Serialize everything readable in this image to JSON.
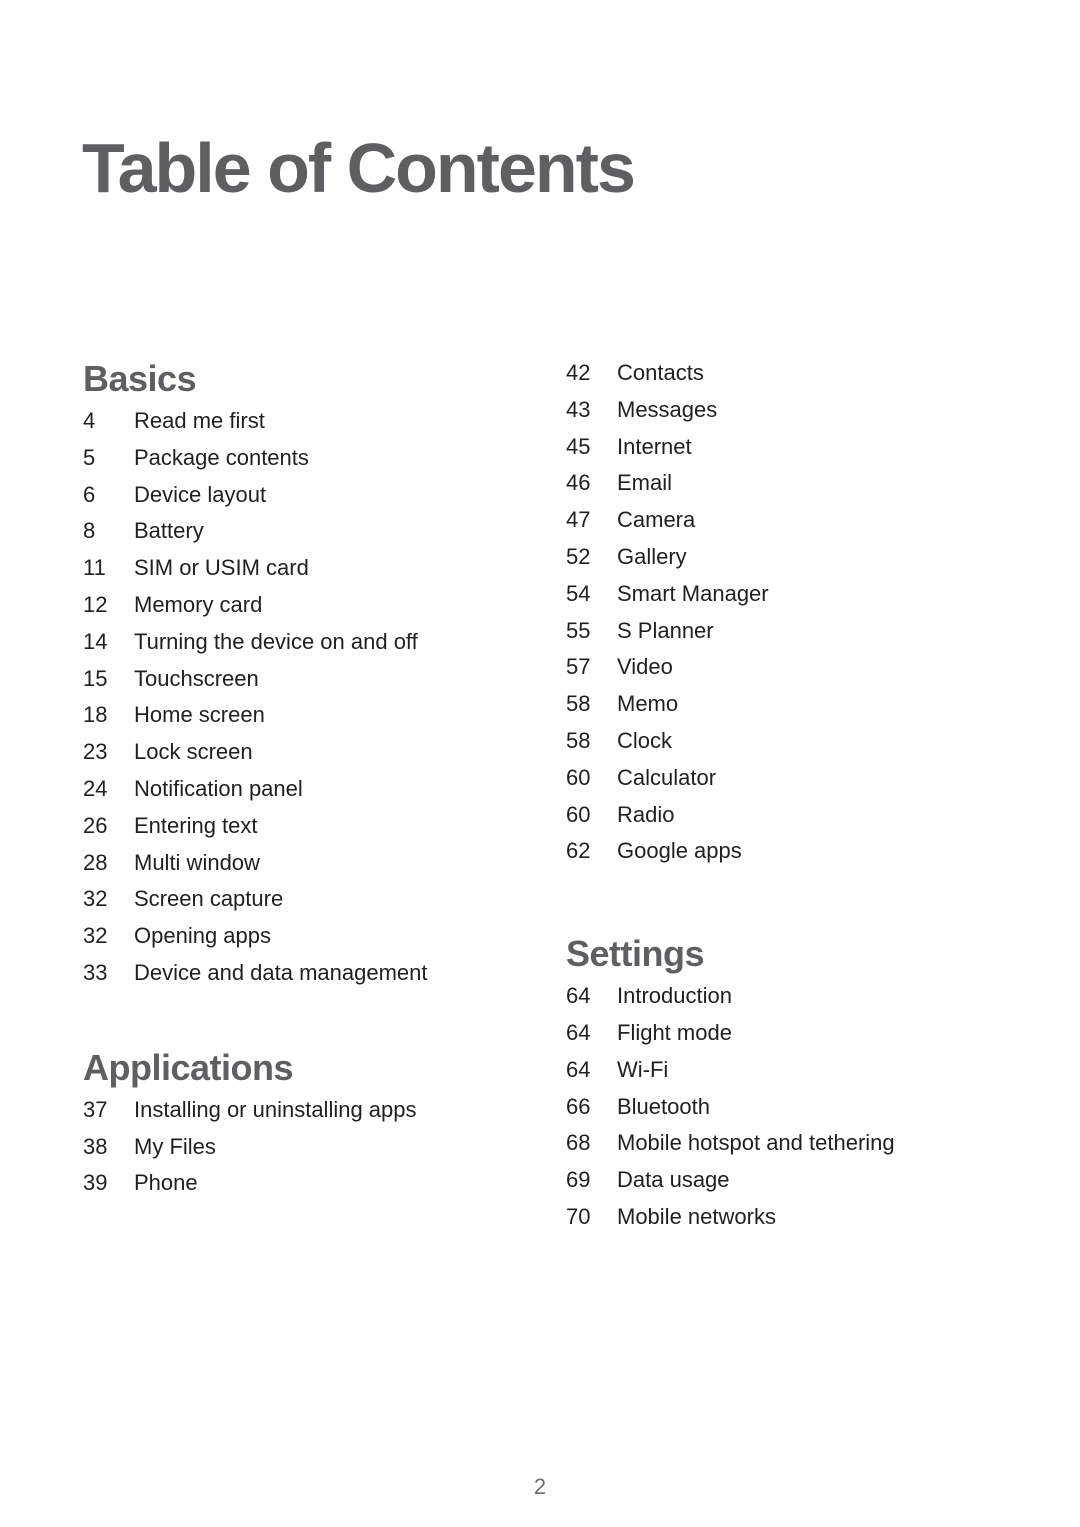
{
  "page_title": "Table of Contents",
  "left_column": {
    "sections": [
      {
        "title": "Basics",
        "items": [
          {
            "page": "4",
            "label": "Read me first"
          },
          {
            "page": "5",
            "label": "Package contents"
          },
          {
            "page": "6",
            "label": "Device layout"
          },
          {
            "page": "8",
            "label": "Battery"
          },
          {
            "page": "11",
            "label": "SIM or USIM card"
          },
          {
            "page": "12",
            "label": "Memory card"
          },
          {
            "page": "14",
            "label": "Turning the device on and off"
          },
          {
            "page": "15",
            "label": "Touchscreen"
          },
          {
            "page": "18",
            "label": "Home screen"
          },
          {
            "page": "23",
            "label": "Lock screen"
          },
          {
            "page": "24",
            "label": "Notification panel"
          },
          {
            "page": "26",
            "label": "Entering text"
          },
          {
            "page": "28",
            "label": "Multi window"
          },
          {
            "page": "32",
            "label": "Screen capture"
          },
          {
            "page": "32",
            "label": "Opening apps"
          },
          {
            "page": "33",
            "label": "Device and data management"
          }
        ]
      },
      {
        "title": "Applications",
        "items": [
          {
            "page": "37",
            "label": "Installing or uninstalling apps"
          },
          {
            "page": "38",
            "label": "My Files"
          },
          {
            "page": "39",
            "label": "Phone"
          }
        ]
      }
    ]
  },
  "right_column": {
    "continued_items": [
      {
        "page": "42",
        "label": "Contacts"
      },
      {
        "page": "43",
        "label": "Messages"
      },
      {
        "page": "45",
        "label": "Internet"
      },
      {
        "page": "46",
        "label": "Email"
      },
      {
        "page": "47",
        "label": "Camera"
      },
      {
        "page": "52",
        "label": "Gallery"
      },
      {
        "page": "54",
        "label": "Smart Manager"
      },
      {
        "page": "55",
        "label": "S Planner"
      },
      {
        "page": "57",
        "label": "Video"
      },
      {
        "page": "58",
        "label": "Memo"
      },
      {
        "page": "58",
        "label": "Clock"
      },
      {
        "page": "60",
        "label": "Calculator"
      },
      {
        "page": "60",
        "label": "Radio"
      },
      {
        "page": "62",
        "label": "Google apps"
      }
    ],
    "sections": [
      {
        "title": "Settings",
        "items": [
          {
            "page": "64",
            "label": "Introduction"
          },
          {
            "page": "64",
            "label": "Flight mode"
          },
          {
            "page": "64",
            "label": "Wi-Fi"
          },
          {
            "page": "66",
            "label": "Bluetooth"
          },
          {
            "page": "68",
            "label": "Mobile hotspot and tethering"
          },
          {
            "page": "69",
            "label": "Data usage"
          },
          {
            "page": "70",
            "label": "Mobile networks"
          }
        ]
      }
    ]
  },
  "footer": {
    "page_number": "2"
  }
}
